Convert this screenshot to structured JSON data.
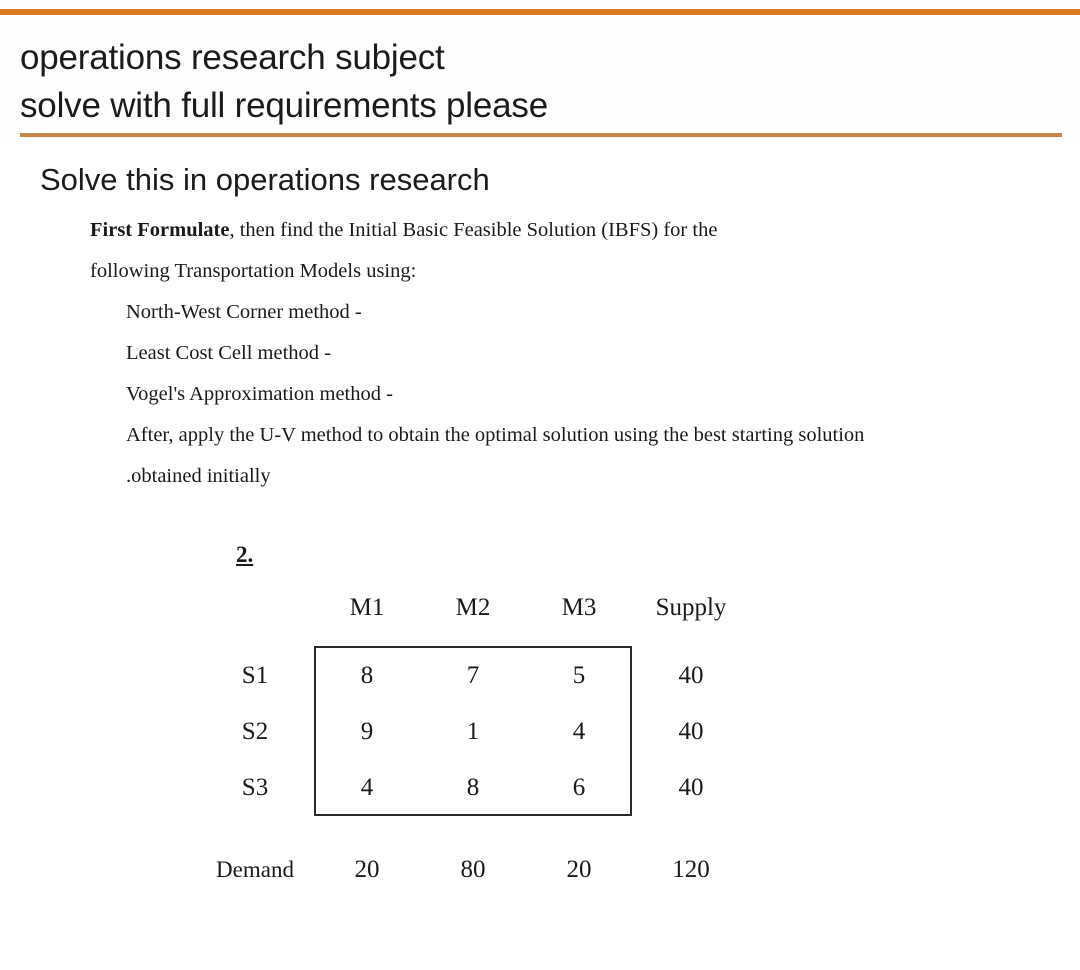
{
  "header": {
    "lines": [
      "operations research subject",
      "solve with full requirements please"
    ],
    "rule_color_top": "#d97a1e",
    "rule_color_bottom": "#c8874a"
  },
  "attachment": {
    "heading": "Solve this in operations research",
    "paragraph": {
      "lead": "First Formulate",
      "line1_rest": ", then find the Initial Basic Feasible Solution (IBFS) for the",
      "line2": "following Transportation Models using:",
      "methods": [
        "North-West Corner method -",
        "Least Cost Cell method -",
        "Vogel's Approximation method -",
        "After, apply the U-V method to obtain the optimal solution using the best starting solution",
        ".obtained initially"
      ]
    },
    "problem": {
      "number": "2.",
      "columns": [
        "M1",
        "M2",
        "M3"
      ],
      "supply_header": "Supply",
      "rows": [
        {
          "label": "S1",
          "costs": [
            "8",
            "7",
            "5"
          ],
          "supply": "40"
        },
        {
          "label": "S2",
          "costs": [
            "9",
            "1",
            "4"
          ],
          "supply": "40"
        },
        {
          "label": "S3",
          "costs": [
            "4",
            "8",
            "6"
          ],
          "supply": "40"
        }
      ],
      "demand_label": "Demand",
      "demand": [
        "20",
        "80",
        "20"
      ],
      "total": "120"
    }
  }
}
